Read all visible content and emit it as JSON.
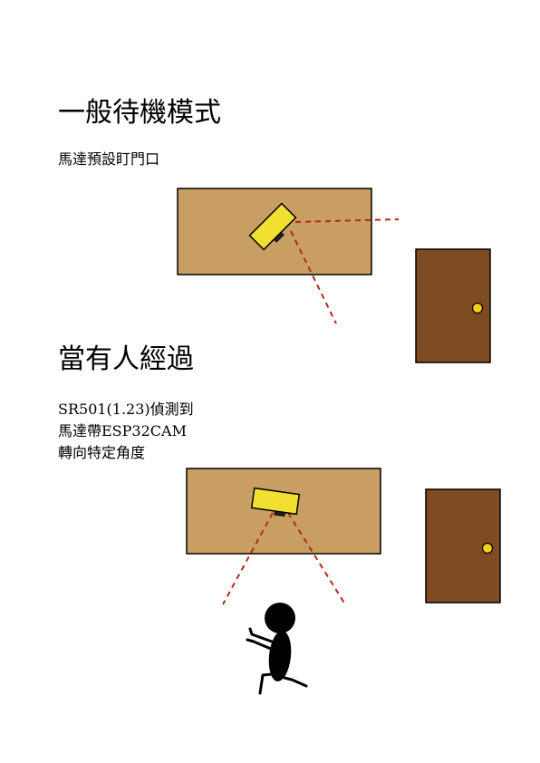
{
  "sections": [
    {
      "title": "一般待機模式",
      "description": [
        "馬達預設盯門口"
      ]
    },
    {
      "title": "當有人經過",
      "description": [
        "SR501(1.23)偵測到",
        "馬達帶ESP32CAM",
        "轉向特定角度"
      ]
    }
  ],
  "colors": {
    "table": "#c99e62",
    "door": "#7f4b22",
    "camera": "#f0e030",
    "knob": "#f5d018",
    "beam": "#b02a1a",
    "person": "#000000"
  }
}
